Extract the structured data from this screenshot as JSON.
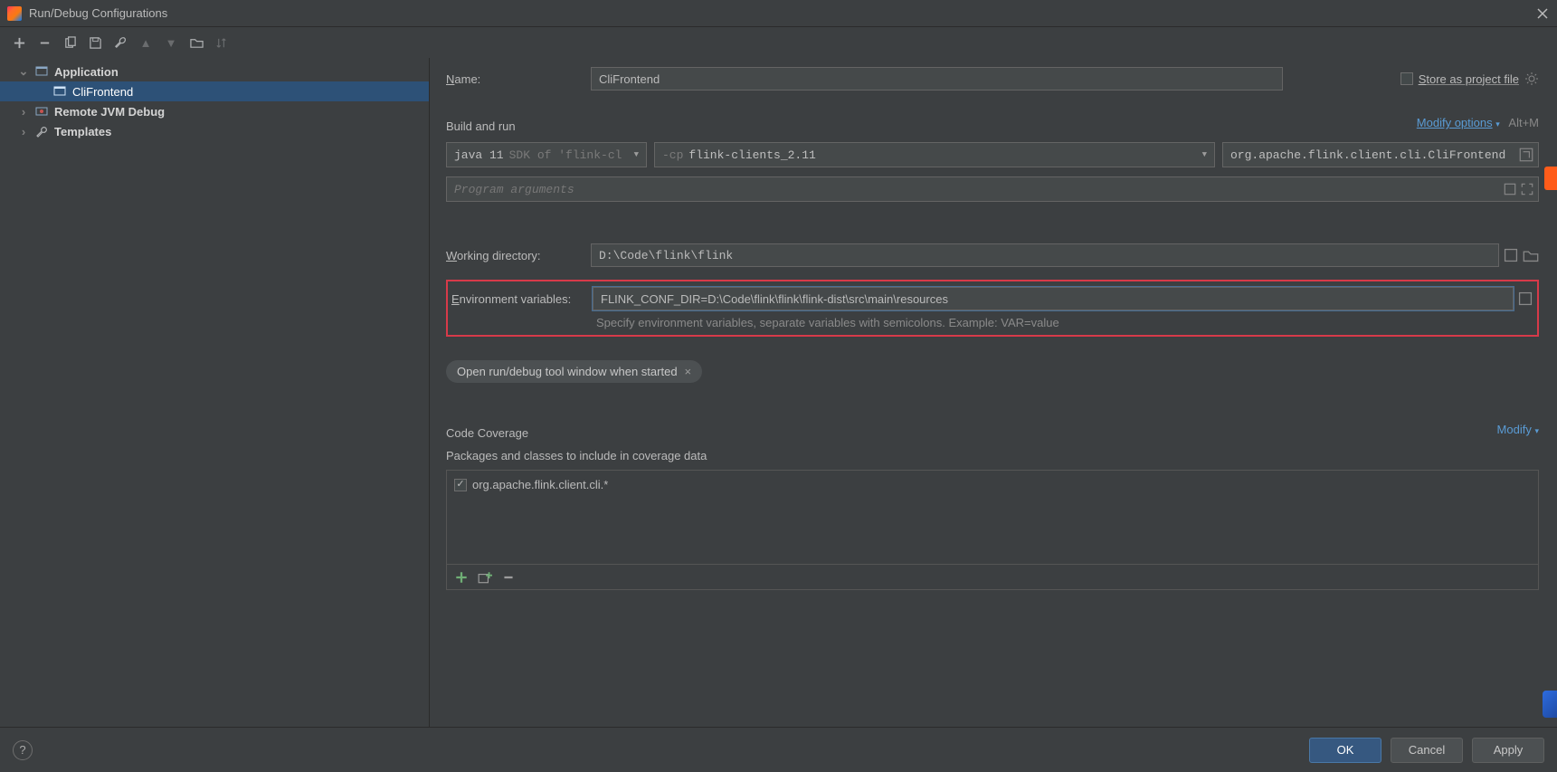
{
  "window": {
    "title": "Run/Debug Configurations"
  },
  "tree": {
    "application": {
      "label": "Application",
      "child": "CliFrontend"
    },
    "remote": "Remote JVM Debug",
    "templates": "Templates"
  },
  "name": {
    "label": "Name:",
    "value": "CliFrontend"
  },
  "store": {
    "label": "Store as project file"
  },
  "buildrun": {
    "title": "Build and run",
    "modify": "Modify options",
    "shortcut": "Alt+M",
    "jre": {
      "prefix": "java 11",
      "suffix": " SDK of 'flink-cl"
    },
    "cp": {
      "prefix": "-cp",
      "value": " flink-clients_2.11"
    },
    "main": "org.apache.flink.client.cli.CliFrontend",
    "progargs_placeholder": "Program arguments"
  },
  "workingdir": {
    "label": "Working directory:",
    "value": "D:\\Code\\flink\\flink"
  },
  "env": {
    "label": "Environment variables:",
    "value": "FLINK_CONF_DIR=D:\\Code\\flink\\flink\\flink-dist\\src\\main\\resources",
    "hint": "Specify environment variables, separate variables with semicolons. Example: VAR=value"
  },
  "chip": {
    "label": "Open run/debug tool window when started"
  },
  "coverage": {
    "title": "Code Coverage",
    "modify": "Modify",
    "subtitle": "Packages and classes to include in coverage data",
    "item": "org.apache.flink.client.cli.*"
  },
  "footer": {
    "ok": "OK",
    "cancel": "Cancel",
    "apply": "Apply"
  }
}
